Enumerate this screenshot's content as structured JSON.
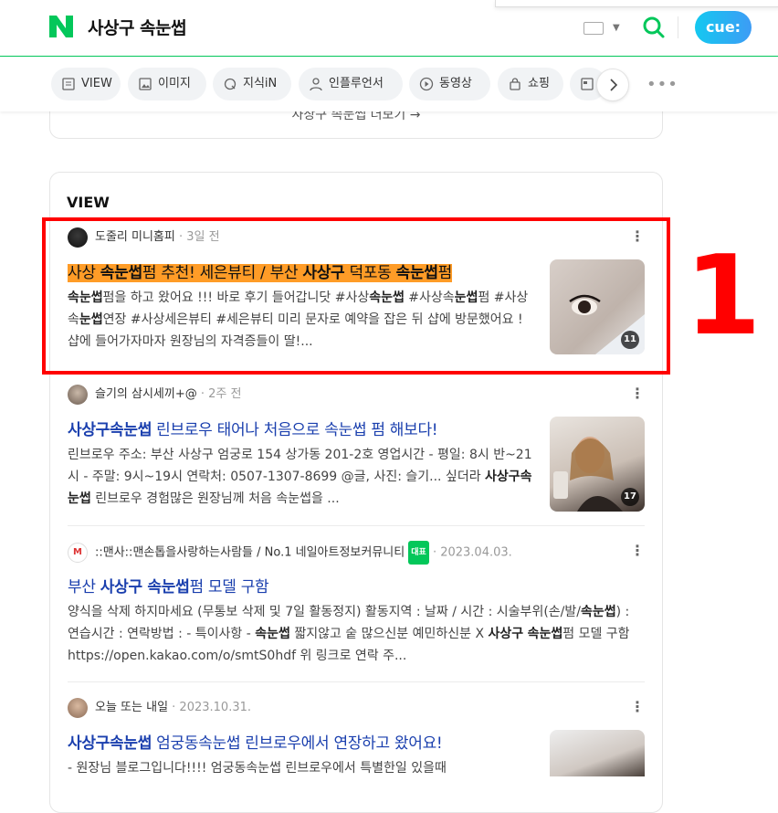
{
  "header": {
    "query": "사상구 속눈썹",
    "cue_label": "cue:"
  },
  "tabs": [
    {
      "label": "VIEW"
    },
    {
      "label": "이미지"
    },
    {
      "label": "지식iN"
    },
    {
      "label": "인플루언서"
    },
    {
      "label": "동영상"
    },
    {
      "label": "쇼핑"
    },
    {
      "label": ""
    }
  ],
  "prev_card": {
    "more_link": "사상구 속눈썹 더보기 →"
  },
  "view": {
    "title": "VIEW",
    "posts": [
      {
        "author": "도줄리 미니홈피",
        "date": "· 3일 전",
        "title_parts": [
          "사상 ",
          "속눈썹",
          "펌 추천! 세은뷰티 / 부산 ",
          "사상구",
          " 덕포동 ",
          "속눈썹",
          "펌"
        ],
        "desc_parts": [
          "속눈썹",
          "펌을 하고 왔어요 !!! 바로 후기 들어갑니닷 #사상",
          "속눈썹",
          " #사상속",
          "눈썹",
          "펌 #사상속",
          "눈썹",
          "연장 #사상세은뷰티 #세은뷰티 미리 문자로 예약을 잡은 뒤 샵에 방문했어요 ! 샵에 들어가자마자 원장님의 자격증들이 딸!..."
        ],
        "image_count": "11"
      },
      {
        "author": "슬기의 삼시세끼+@",
        "date": "· 2주 전",
        "title_parts": [
          "사상구속눈썹",
          " 린브로우 태어나 처음으로 속눈썹 펌 해보다!"
        ],
        "desc_parts": [
          "린브로우 주소: 부산 사상구 엄궁로 154 상가동 201-2호 영업시간 - 평일: 8시 반~21시 - 주말: 9시~19시 연락처: 0507-1307-8699 @글, 사진: 슬기... 싶더라 ",
          "사상구속눈썹",
          " 린브로우 경험많은 원장님께 처음 속눈썹을 ..."
        ],
        "image_count": "17"
      },
      {
        "author": "::맨사::맨손톱을사랑하는사람들 / No.1 네일아트정보커뮤니티",
        "badge": "대표",
        "date": "· 2023.04.03.",
        "title_parts": [
          "부산 ",
          "사상구 속눈썹",
          "펌 모델 구함"
        ],
        "desc_parts": [
          "양식을 삭제 하지마세요 (무통보 삭제 및 7일 활동정지) 활동지역 : 날짜 / 시간 : 시술부위(손/발/",
          "속눈썹",
          ") : 연습시간 : 연락방법 : - 특이사항 - ",
          "속눈썹",
          " 짧지않고 숱 많으신분 예민하신분 X ",
          "사상구",
          " ",
          "속눈썹",
          "펌 모델 구함 https://open.kakao.com/o/smtS0hdf 위 링크로 연락 주..."
        ]
      },
      {
        "author": "오늘 또는 내일",
        "date": "· 2023.10.31.",
        "title_parts": [
          "사상구속눈썹",
          " 엄궁동속눈썹 린브로우에서 연장하고 왔어요!"
        ],
        "desc_parts": [
          "- 원장님 블로그입니다!!!! 엄궁동속눈썹 린브로우에서 특별한일 있을때"
        ]
      }
    ]
  },
  "annotation": {
    "label": "1"
  },
  "colors": {
    "naver_green": "#03c75a",
    "link_blue": "#1a3fae",
    "highlight": "#ff9c27",
    "annotation_red": "#ff0000"
  }
}
